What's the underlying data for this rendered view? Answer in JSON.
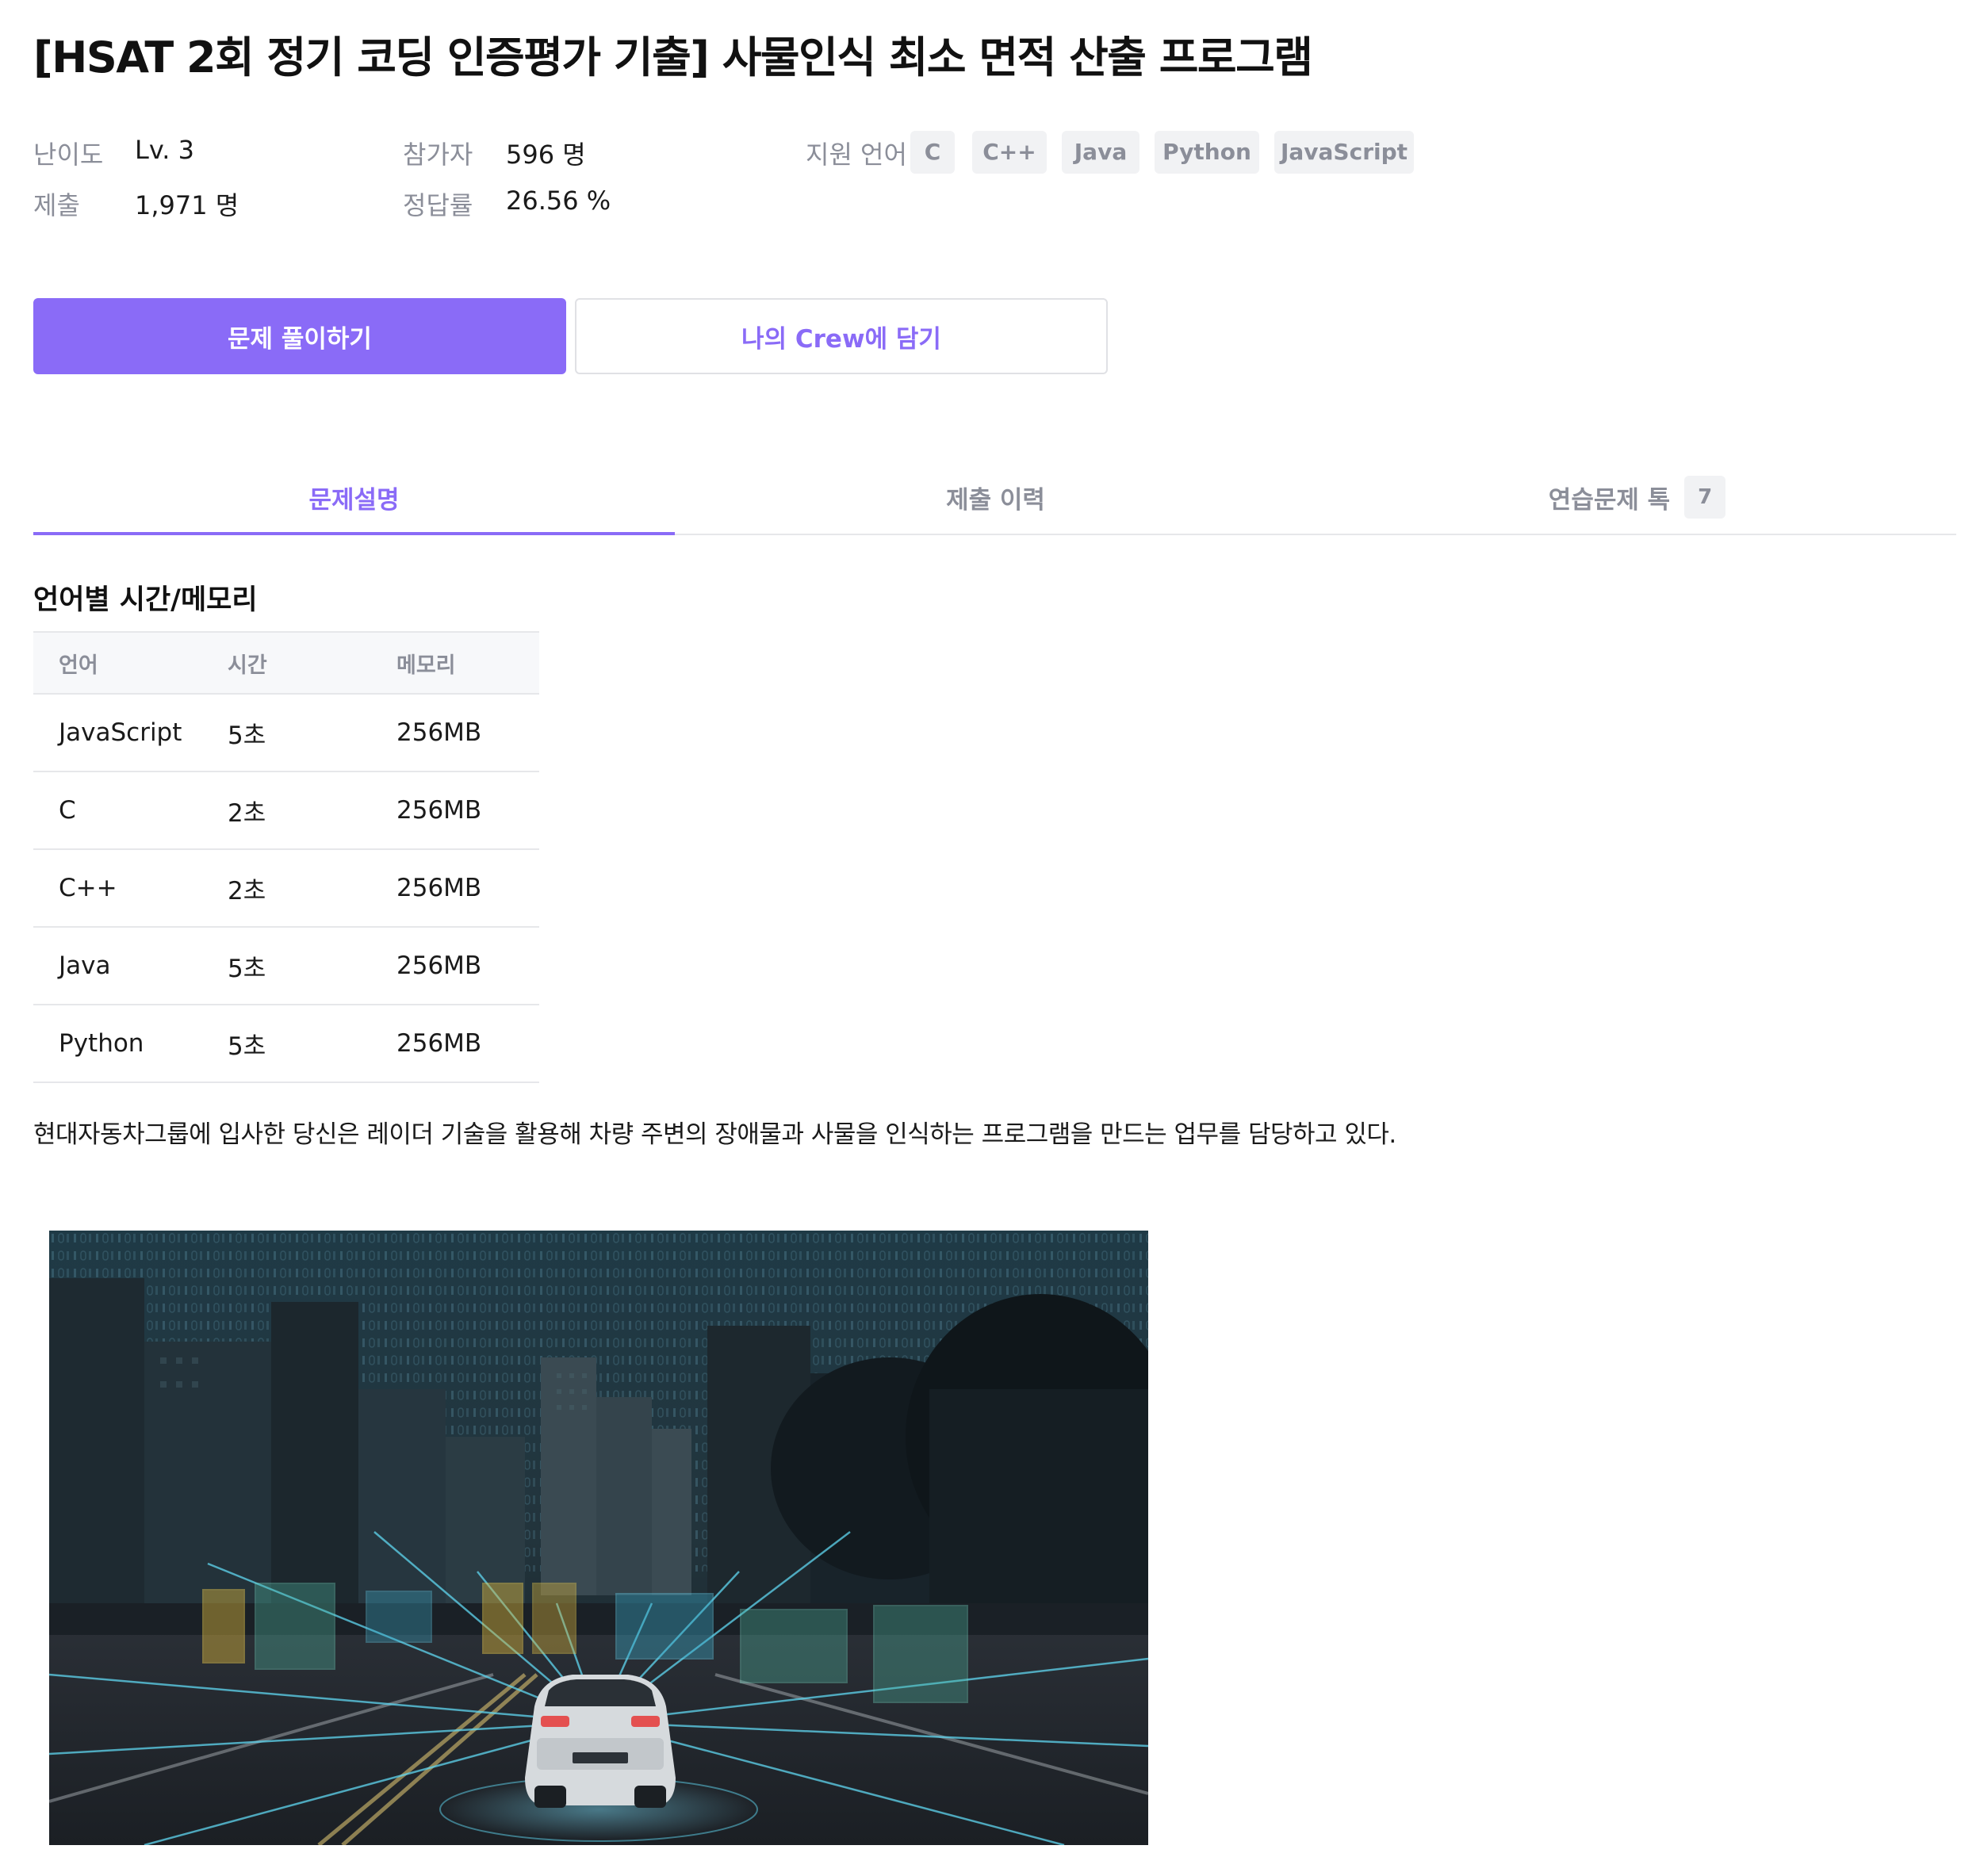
{
  "problem": {
    "title": "[HSAT 2회 정기 코딩 인증평가 기출] 사물인식 최소 면적 산출 프로그램"
  },
  "meta": {
    "difficulty_label": "난이도",
    "difficulty_value": "Lv. 3",
    "participants_label": "참가자",
    "participants_value": "596 명",
    "submissions_label": "제출",
    "submissions_value": "1,971 명",
    "accuracy_label": "정답률",
    "accuracy_value": "26.56 %",
    "languages_label": "지원 언어",
    "languages": [
      "C",
      "C++",
      "Java",
      "Python",
      "JavaScript"
    ]
  },
  "actions": {
    "solve_label": "문제 풀이하기",
    "crew_label": "나의 Crew에 담기"
  },
  "tabs": [
    {
      "label": "문제설명",
      "active": true
    },
    {
      "label": "제출 이력",
      "active": false
    },
    {
      "label": "연습문제 톡",
      "count": "7",
      "active": false
    }
  ],
  "limits": {
    "title": "언어별 시간/메모리",
    "headers": [
      "언어",
      "시간",
      "메모리"
    ],
    "rows": [
      [
        "JavaScript",
        "5초",
        "256MB"
      ],
      [
        "C",
        "2초",
        "256MB"
      ],
      [
        "C++",
        "2초",
        "256MB"
      ],
      [
        "Java",
        "5초",
        "256MB"
      ],
      [
        "Python",
        "5초",
        "256MB"
      ]
    ]
  },
  "description": {
    "paragraph": "현대자동차그룹에 입사한 당신은 레이더 기술을 활용해 차량 주변의 장애물과 사물을 인식하는 프로그램을 만드는 업무를 담당하고 있다."
  },
  "colors": {
    "accent": "#8a6bf7",
    "muted_text": "#8b8e99",
    "chip_bg": "#f1f2f4",
    "divider": "#e6e7ea"
  }
}
